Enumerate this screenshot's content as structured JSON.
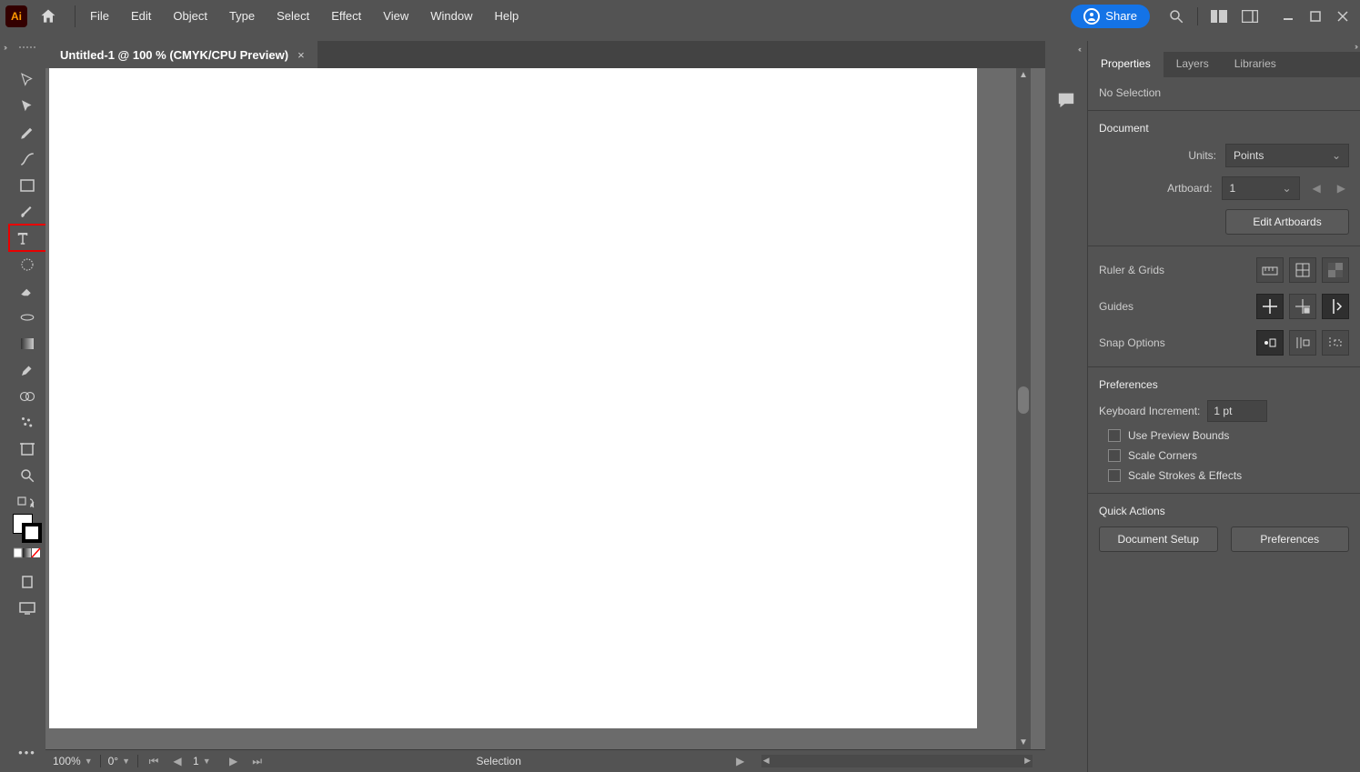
{
  "menubar": {
    "items": [
      "File",
      "Edit",
      "Object",
      "Type",
      "Select",
      "Effect",
      "View",
      "Window",
      "Help"
    ],
    "share_label": "Share"
  },
  "document": {
    "tab_title": "Untitled-1 @ 100 % (CMYK/CPU Preview)"
  },
  "statusbar": {
    "zoom": "100%",
    "rotation": "0°",
    "artboard_page": "1",
    "tool_label": "Selection"
  },
  "panel": {
    "tabs": [
      "Properties",
      "Layers",
      "Libraries"
    ],
    "selection_status": "No Selection",
    "sections": {
      "document": {
        "title": "Document",
        "units_label": "Units:",
        "units_value": "Points",
        "artboard_label": "Artboard:",
        "artboard_value": "1",
        "edit_artboards_label": "Edit Artboards"
      },
      "ruler_grids_label": "Ruler & Grids",
      "guides_label": "Guides",
      "snap_label": "Snap Options",
      "preferences": {
        "title": "Preferences",
        "keyboard_increment_label": "Keyboard Increment:",
        "keyboard_increment_value": "1 pt",
        "use_preview_bounds_label": "Use Preview Bounds",
        "scale_corners_label": "Scale Corners",
        "scale_strokes_label": "Scale Strokes & Effects"
      },
      "quick_actions": {
        "title": "Quick Actions",
        "document_setup_label": "Document Setup",
        "preferences_label": "Preferences"
      }
    }
  }
}
